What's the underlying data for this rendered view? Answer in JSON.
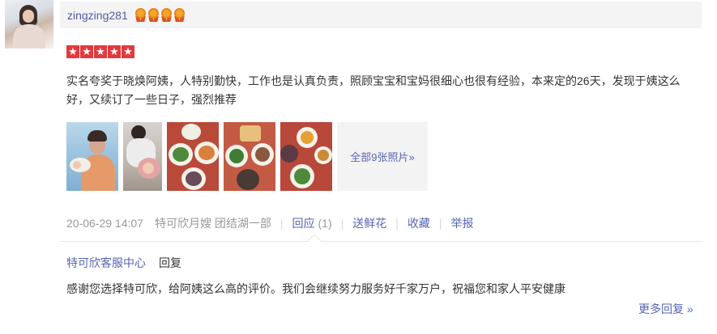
{
  "user": {
    "name": "zingzing281",
    "medals": [
      "medal-icon",
      "medal-icon",
      "medal-icon",
      "medal-icon"
    ]
  },
  "review": {
    "rating": 5,
    "star_glyph": "★",
    "text": "实名夸奖于晓焕阿姨，人特别勤快，工作也是认真负责，照顾宝宝和宝妈很细心也很有经验，本来定的26天，发现于姨这么好，又续订了一些日子，强烈推荐",
    "photos_link": "全部9张照片»"
  },
  "meta": {
    "date": "20-06-29 14:07",
    "author": "特可欣月嫂 团结湖一部",
    "reply_label": "回应",
    "reply_count": "(1)",
    "flowers_label": "送鲜花",
    "favorite_label": "收藏",
    "report_label": "举报",
    "separator": "|"
  },
  "reply": {
    "name": "特可欣客服中心",
    "tag": "回复",
    "text": "感谢您选择特可欣，给阿姨这么高的评价。我们会继续努力服务好千家万户，祝福您和家人平安健康",
    "more_label": "更多回复 »"
  },
  "colors": {
    "link": "#5765b3",
    "star": "#e4393c",
    "medal": "#f4a728"
  }
}
